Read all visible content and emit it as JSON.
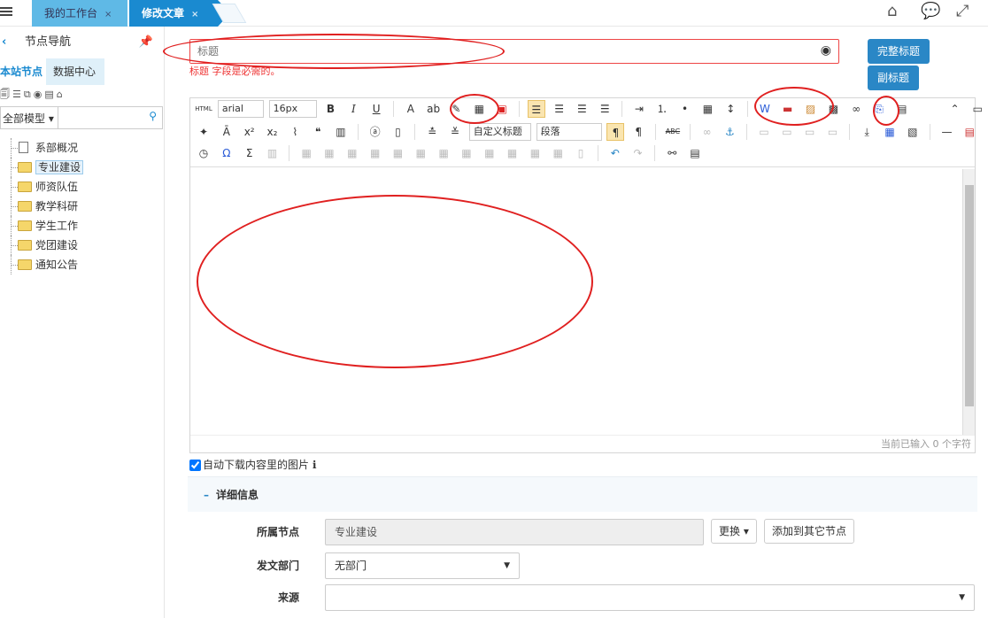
{
  "tabs": [
    {
      "label": "我的工作台"
    },
    {
      "label": "修改文章"
    }
  ],
  "tab_close": "×",
  "sidebar": {
    "title": "节点导航",
    "tab_site": "本站节点",
    "tab_data": "数据中心",
    "model_select": "全部模型",
    "tree": [
      {
        "label": "系部概况",
        "type": "doc"
      },
      {
        "label": "专业建设",
        "type": "folder",
        "selected": true
      },
      {
        "label": "师资队伍",
        "type": "folder"
      },
      {
        "label": "教学科研",
        "type": "folder"
      },
      {
        "label": "学生工作",
        "type": "folder"
      },
      {
        "label": "党团建设",
        "type": "folder"
      },
      {
        "label": "通知公告",
        "type": "folder"
      }
    ]
  },
  "title_field": {
    "placeholder": "标题",
    "error": "标题 字段是必需的。"
  },
  "buttons": {
    "full_title": "完整标题",
    "sub_title": "副标题"
  },
  "editor": {
    "font_family": "arial",
    "font_size": "16px",
    "custom_title": "自定义标题",
    "paragraph": "段落",
    "counter": "当前已输入 0 个字符"
  },
  "auto_download": "自动下载内容里的图片",
  "detail": {
    "header": "详细信息",
    "node_label": "所属节点",
    "node_value": "专业建设",
    "change_btn": "更换",
    "add_btn": "添加到其它节点",
    "dept_label": "发文部门",
    "dept_value": "无部门",
    "source_label": "来源"
  },
  "colors": {
    "accent": "#2a87c6",
    "annotation": "#e02020"
  }
}
